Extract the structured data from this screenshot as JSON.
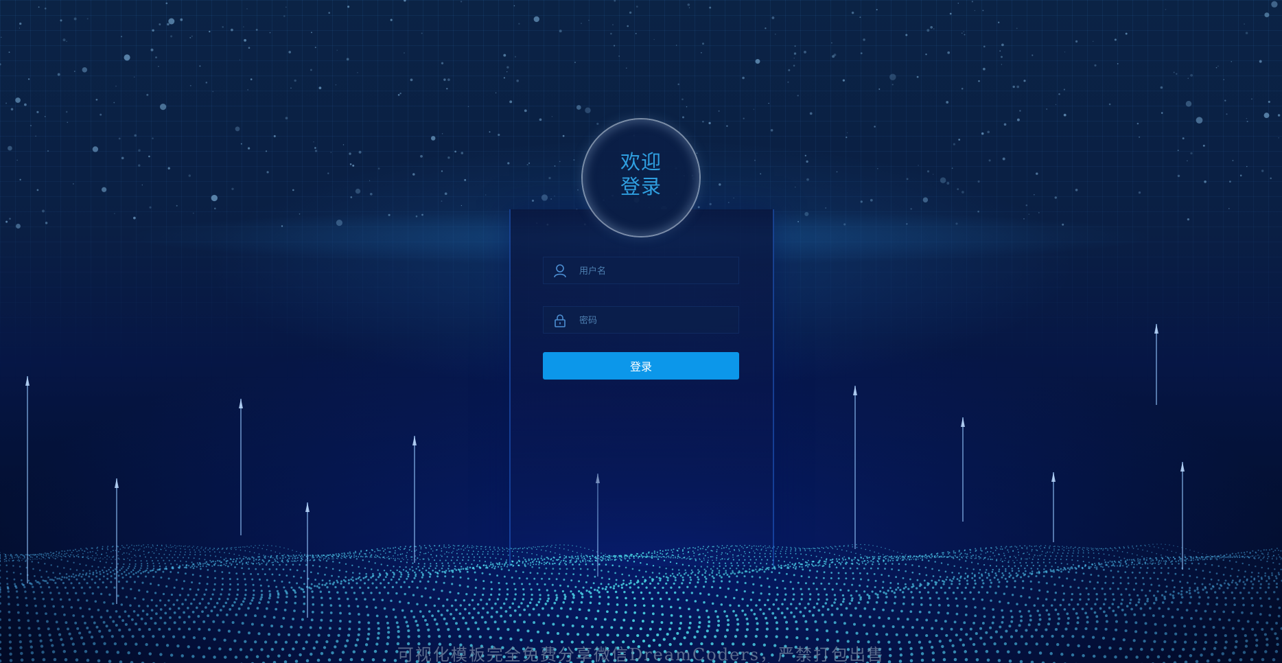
{
  "welcome": {
    "line1": "欢迎",
    "line2": "登录"
  },
  "form": {
    "username_placeholder": "用户名",
    "password_placeholder": "密码",
    "login_label": "登录"
  },
  "footer_text": "可视化模板完全免费分享微信DreamCoders，严禁打包出售",
  "icons": {
    "username": "user-icon",
    "password": "lock-icon"
  },
  "colors": {
    "accent": "#0c97ea",
    "welcome_text": "#2f9fe0",
    "field_bg": "#0a1e4b",
    "background": "#020b2a"
  }
}
